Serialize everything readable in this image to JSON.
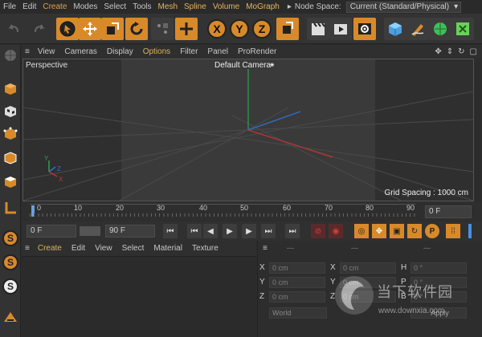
{
  "menu": {
    "items": [
      "File",
      "Edit",
      "Create",
      "Modes",
      "Select",
      "Tools",
      "Mesh",
      "Spline",
      "Volume",
      "MoGraph"
    ],
    "node_space_label": "Node Space:",
    "node_space_value": "Current (Standard/Physical)"
  },
  "toolbar": {
    "axis_x": "X",
    "axis_y": "Y",
    "axis_z": "Z"
  },
  "viewport_menu": {
    "items": [
      "View",
      "Cameras",
      "Display",
      "Options",
      "Filter",
      "Panel",
      "ProRender"
    ]
  },
  "viewport": {
    "label": "Perspective",
    "camera": "Default Camera",
    "grid_spacing": "Grid Spacing : 1000 cm",
    "axis_y": "Y",
    "axis_z": "Z",
    "axis_x": "X"
  },
  "timeline": {
    "ticks": [
      "0",
      "10",
      "20",
      "30",
      "40",
      "50",
      "60",
      "70",
      "80",
      "90"
    ],
    "current_frame": "0 F"
  },
  "transport": {
    "start_frame": "0 F",
    "end_frame": "90 F"
  },
  "material_menu": {
    "items": [
      "Create",
      "Edit",
      "View",
      "Select",
      "Material",
      "Texture"
    ]
  },
  "coords": {
    "headers": [
      "---",
      "---",
      "---"
    ],
    "rows": [
      {
        "a_label": "X",
        "a_value": "0 cm",
        "b_label": "X",
        "b_value": "0 cm",
        "c_label": "H",
        "c_value": "0 °"
      },
      {
        "a_label": "Y",
        "a_value": "0 cm",
        "b_label": "Y",
        "b_value": "0 cm",
        "c_label": "P",
        "c_value": "0 °"
      },
      {
        "a_label": "Z",
        "a_value": "0 cm",
        "b_label": "Z",
        "b_value": "0 cm",
        "c_label": "B",
        "c_value": "0 °"
      }
    ],
    "mode": "World",
    "apply_label": "Apply"
  },
  "watermark": {
    "title": "当下软件园",
    "url": "www.downxia.com"
  },
  "colors": {
    "accent_orange": "#d88a2a",
    "highlight_text": "#e0a04a",
    "axis_x": "#c03030",
    "axis_y": "#2fa04a",
    "axis_z": "#2f6fd0"
  }
}
